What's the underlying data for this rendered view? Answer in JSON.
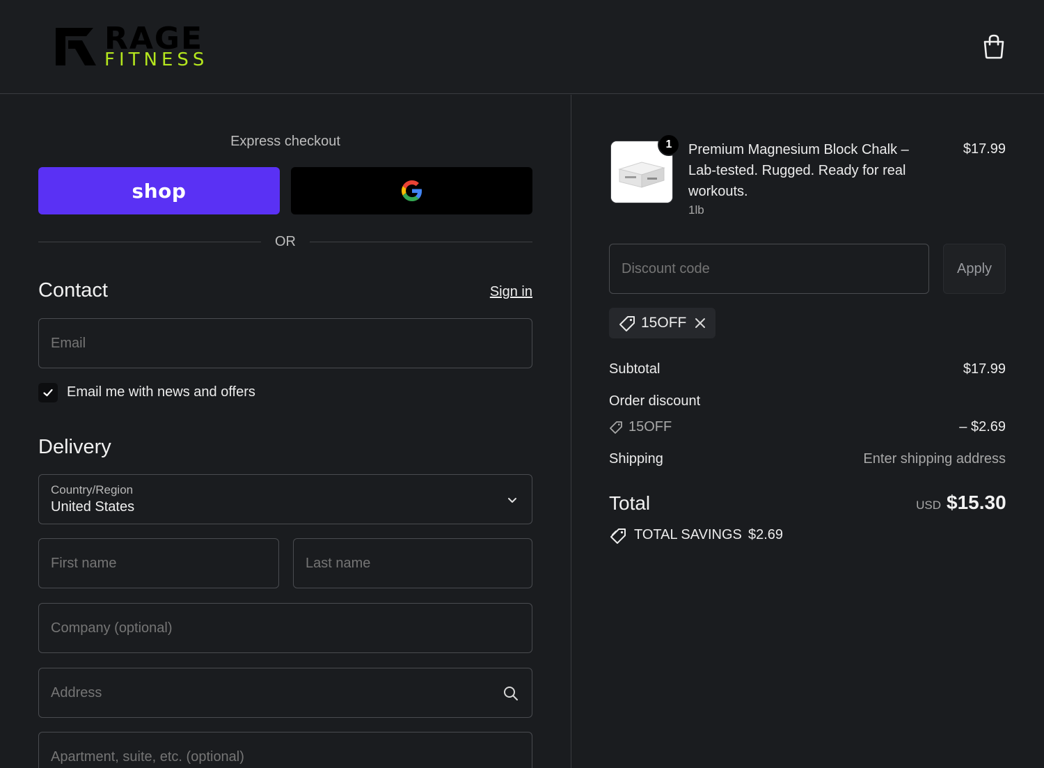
{
  "brand": {
    "name_top": "RAGE",
    "name_bottom": "FITNESS",
    "accent_color": "#b4e61e"
  },
  "header": {
    "cart_icon": "shopping-bag-icon"
  },
  "express": {
    "label": "Express checkout",
    "shop_pay_label": "shop",
    "shop_pay_color": "#5a31f4",
    "google_pay_icon": "google-g-icon",
    "or_text": "OR"
  },
  "contact": {
    "title": "Contact",
    "sign_in": "Sign in",
    "email_placeholder": "Email",
    "marketing_checkbox_label": "Email me with news and offers",
    "marketing_checked": true
  },
  "delivery": {
    "title": "Delivery",
    "country_label": "Country/Region",
    "country_value": "United States",
    "first_name_placeholder": "First name",
    "last_name_placeholder": "Last name",
    "company_placeholder": "Company (optional)",
    "address_placeholder": "Address",
    "apartment_placeholder": "Apartment, suite, etc. (optional)"
  },
  "order": {
    "item": {
      "quantity": "1",
      "name": "Premium Magnesium Block Chalk – Lab-tested. Rugged. Ready for real workouts.",
      "variant": "1lb",
      "price": "$17.99"
    },
    "discount_placeholder": "Discount code",
    "apply_label": "Apply",
    "applied_code": "15OFF",
    "subtotal_label": "Subtotal",
    "subtotal_value": "$17.99",
    "order_discount_label": "Order discount",
    "discount_code": "15OFF",
    "discount_value": "– $2.69",
    "shipping_label": "Shipping",
    "shipping_value": "Enter shipping address",
    "total_label": "Total",
    "currency": "USD",
    "total_value": "$15.30",
    "savings_label": "TOTAL SAVINGS",
    "savings_value": "$2.69"
  }
}
